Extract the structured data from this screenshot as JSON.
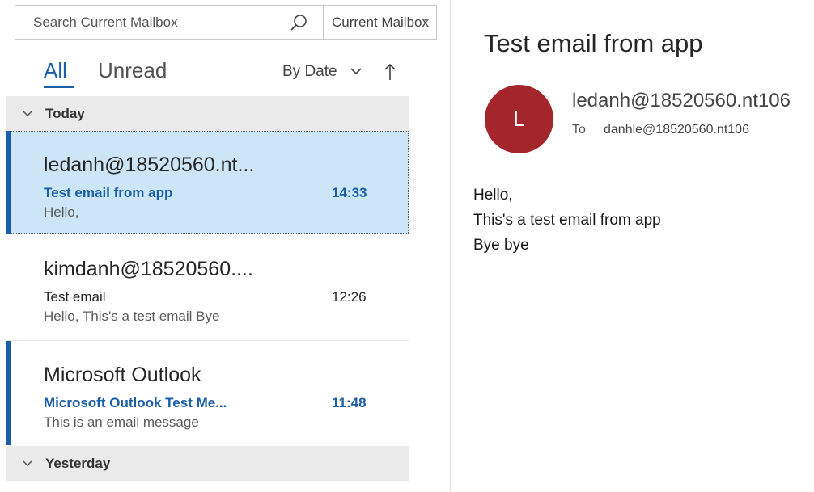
{
  "search": {
    "placeholder": "Search Current Mailbox",
    "scope": "Current Mailbox"
  },
  "filters": {
    "all": "All",
    "unread": "Unread",
    "sort": "By Date"
  },
  "groups": {
    "today": "Today",
    "yesterday": "Yesterday"
  },
  "messages": [
    {
      "sender": "ledanh@18520560.nt...",
      "subject": "Test email from app",
      "time": "14:33",
      "preview": "Hello,",
      "unread": true,
      "selected": true
    },
    {
      "sender": "kimdanh@18520560....",
      "subject": "Test email",
      "time": "12:26",
      "preview": "Hello,  This's a test email  Bye",
      "unread": false,
      "selected": false
    },
    {
      "sender": "Microsoft Outlook",
      "subject": "Microsoft Outlook Test Me...",
      "time": "11:48",
      "preview": "This is an email message",
      "unread": true,
      "selected": false
    }
  ],
  "reading": {
    "subject": "Test email from app",
    "avatar_initial": "L",
    "avatar_color": "#a4262c",
    "from": "ledanh@18520560.nt106",
    "to_label": "To",
    "to": "danhle@18520560.nt106",
    "body": [
      "Hello,",
      "This's a test email from app",
      "Bye bye"
    ]
  },
  "colors": {
    "accent": "#1a5ea8",
    "selected_bg": "#cde6f7",
    "group_bg": "#eaeaea"
  }
}
